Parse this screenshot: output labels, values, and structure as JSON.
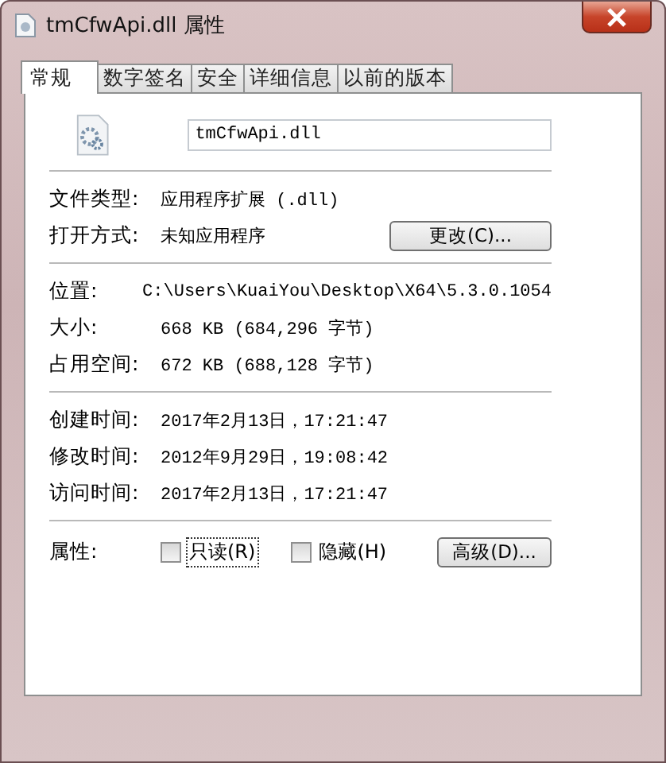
{
  "window": {
    "title": "tmCfwApi.dll 属性"
  },
  "tabs": [
    {
      "label": "常规",
      "selected": true
    },
    {
      "label": "数字签名",
      "selected": false
    },
    {
      "label": "安全",
      "selected": false
    },
    {
      "label": "详细信息",
      "selected": false
    },
    {
      "label": "以前的版本",
      "selected": false
    }
  ],
  "file_name": "tmCfwApi.dll",
  "sections": [
    [
      {
        "label": "文件类型:",
        "value": "应用程序扩展 (.dll)"
      },
      {
        "label": "打开方式:",
        "value": "未知应用程序",
        "button": "更改(C)..."
      }
    ],
    [
      {
        "label": "位置:",
        "value": "C:\\Users\\KuaiYou\\Desktop\\X64\\5.3.0.1054"
      },
      {
        "label": "大小:",
        "value": "668 KB (684,296 字节)"
      },
      {
        "label": "占用空间:",
        "value": "672 KB (688,128 字节)"
      }
    ],
    [
      {
        "label": "创建时间:",
        "value": "2017年2月13日，17:21:47"
      },
      {
        "label": "修改时间:",
        "value": "2012年9月29日，19:08:42"
      },
      {
        "label": "访问时间:",
        "value": "2017年2月13日，17:21:47"
      }
    ]
  ],
  "attributes": {
    "label": "属性:",
    "checkboxes": [
      {
        "label": "只读(R)",
        "checked": false,
        "focused": true
      },
      {
        "label": "隐藏(H)",
        "checked": false,
        "focused": false
      }
    ],
    "button": "高级(D)..."
  }
}
